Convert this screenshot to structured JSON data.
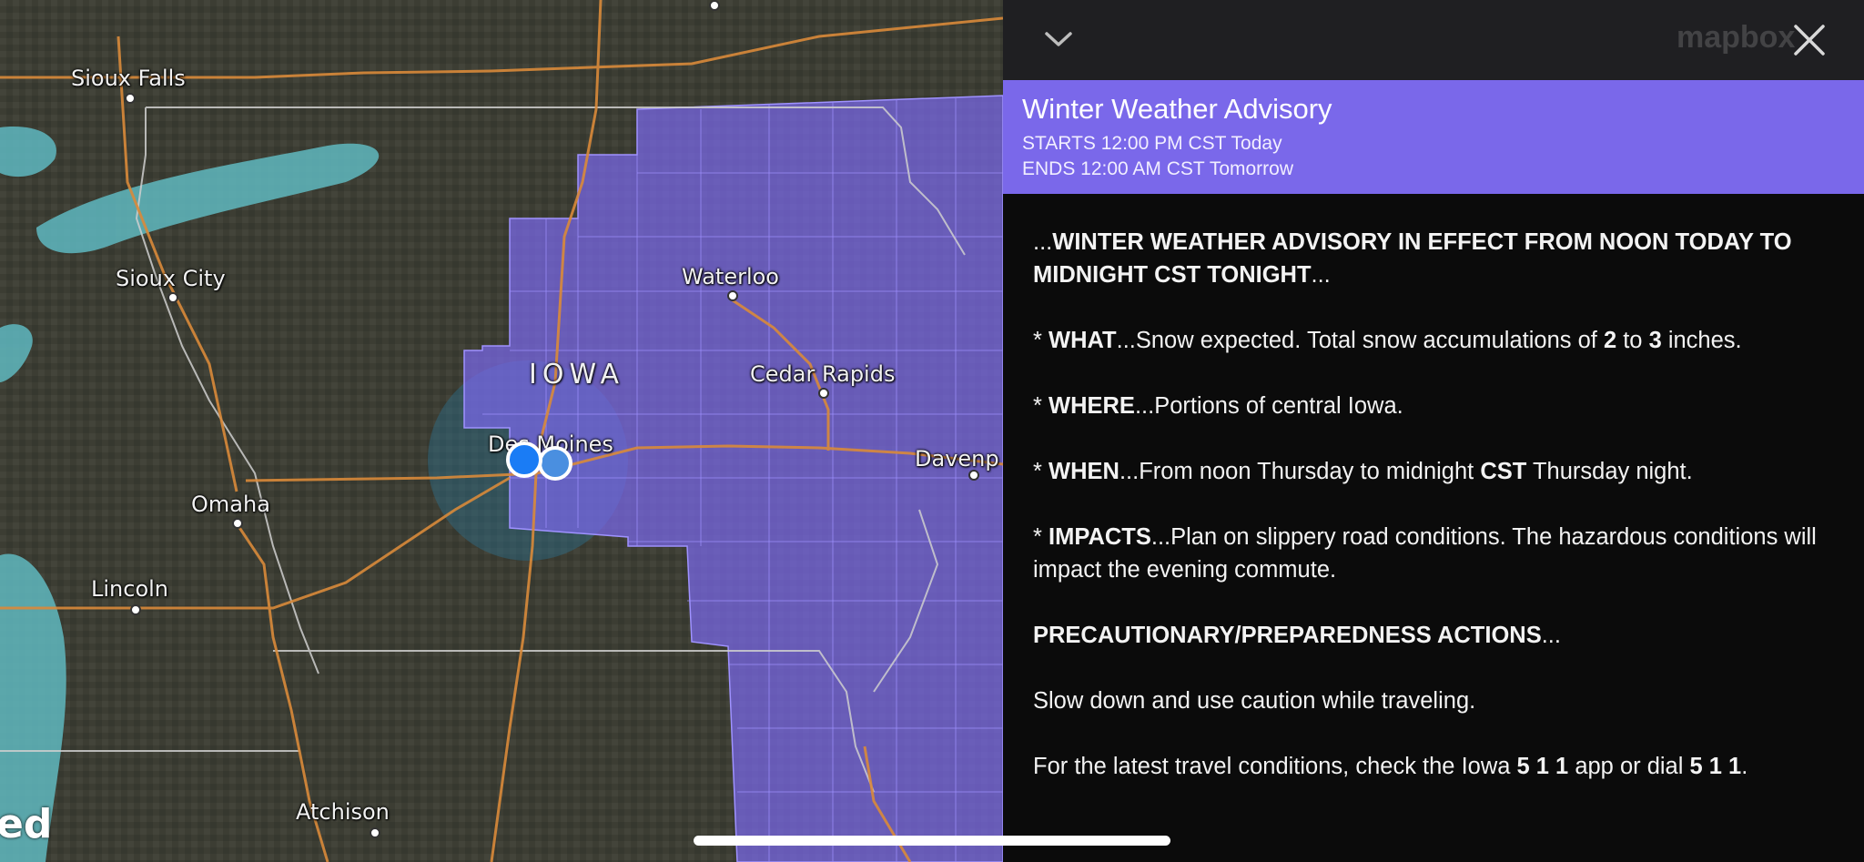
{
  "map": {
    "cities": [
      {
        "name": "Sioux Falls"
      },
      {
        "name": "Sioux City"
      },
      {
        "name": "Waterloo"
      },
      {
        "name": "Cedar Rapids"
      },
      {
        "name": "Des Moines"
      },
      {
        "name": "Omaha"
      },
      {
        "name": "Lincoln"
      },
      {
        "name": "Davenp"
      },
      {
        "name": "Atchison"
      }
    ],
    "state_label": "IOWA",
    "edge_text": "ed",
    "advisory_color": "#7a68ea",
    "precip_color": "#5fb8c0",
    "location_color": "#1a7cf5"
  },
  "watermark": "mapbox",
  "panel": {
    "collapse_icon": "chevron-down-icon",
    "close_icon": "close-icon",
    "banner": {
      "title": "Winter Weather Advisory",
      "starts": "STARTS 12:00 PM CST Today",
      "ends": "ENDS 12:00 AM CST Tomorrow",
      "color": "#7a68ea"
    },
    "body": {
      "p1_prefix": "...",
      "p1_bold": "WINTER WEATHER ADVISORY IN EFFECT FROM NOON TODAY TO MIDNIGHT CST TONIGHT",
      "p1_suffix": "...",
      "what_label": "WHAT",
      "what_text_a": "...Snow expected. Total snow accumulations of ",
      "what_num1": "2",
      "what_text_b": " to ",
      "what_num2": "3",
      "what_text_c": " inches.",
      "where_label": "WHERE",
      "where_text": "...Portions of central Iowa.",
      "when_label": "WHEN",
      "when_text_a": "...From noon Thursday to midnight ",
      "when_bold": "CST",
      "when_text_b": " Thursday night.",
      "impacts_label": "IMPACTS",
      "impacts_text": "...Plan on slippery road conditions. The hazardous conditions will impact the evening commute.",
      "precaution_bold": "PRECAUTIONARY/PREPAREDNESS ACTIONS",
      "precaution_suffix": "...",
      "slow_text": "Slow down and use caution while traveling.",
      "latest_text_a": "For the latest travel conditions, check the Iowa ",
      "latest_bold1": "5 1 1",
      "latest_text_b": " app or dial ",
      "latest_bold2": "5 1 1",
      "latest_text_c": "."
    }
  }
}
